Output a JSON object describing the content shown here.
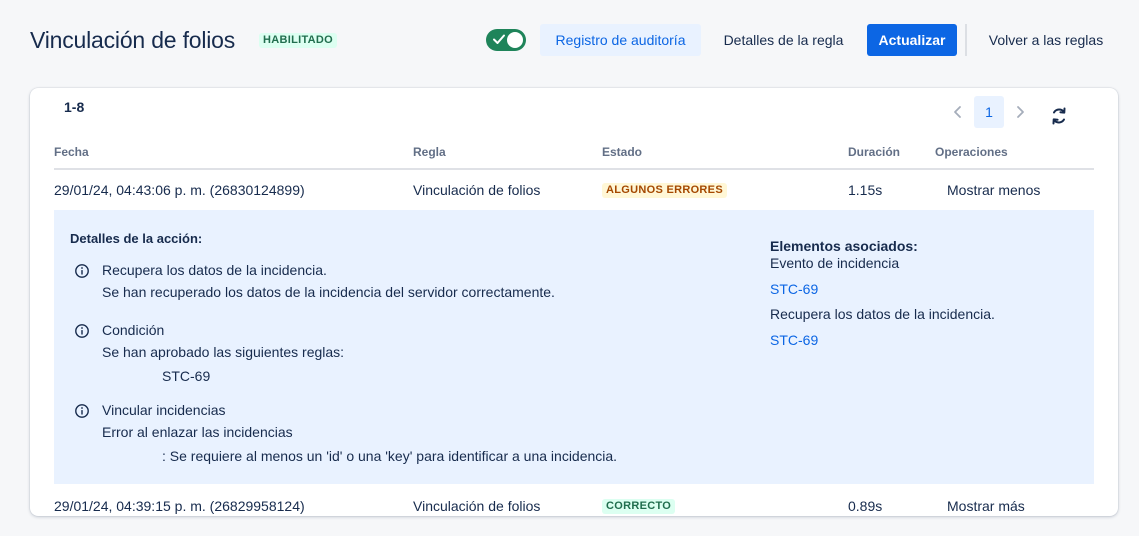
{
  "header": {
    "title": "Vinculación de folios",
    "status_badge": "HABILITADO",
    "toggle_on": true,
    "audit_button": "Registro de auditoría",
    "details_button": "Detalles de la regla",
    "update_button": "Actualizar",
    "back_button": "Volver a las reglas"
  },
  "table": {
    "range": "1-8",
    "pagination": {
      "current_page": "1"
    },
    "columns": [
      "Fecha",
      "Regla",
      "Estado",
      "Duración",
      "Operaciones"
    ],
    "rows": [
      {
        "date": "29/01/24, 04:43:06 p. m. (26830124899)",
        "rule": "Vinculación de folios",
        "status": "ALGUNOS ERRORES",
        "duration": "1.15s",
        "operation": "Mostrar menos"
      },
      {
        "date": "29/01/24, 04:39:15 p. m. (26829958124)",
        "rule": "Vinculación de folios",
        "status": "CORRECTO",
        "duration": "0.89s",
        "operation": "Mostrar más"
      }
    ]
  },
  "detail": {
    "title": "Detalles de la acción:",
    "actions": [
      {
        "title": "Recupera los datos de la incidencia.",
        "lines": [
          "Se han recuperado los datos de la incidencia del servidor correctamente."
        ]
      },
      {
        "title": "Condición",
        "lines": [
          "Se han aprobado las siguientes reglas:",
          "STC-69"
        ]
      },
      {
        "title": "Vincular incidencias",
        "lines": [
          "Error al enlazar las incidencias",
          ": Se requiere al menos un 'id' o una 'key' para identificar a una incidencia."
        ]
      }
    ],
    "associated": {
      "title": "Elementos asociados:",
      "items": [
        "Evento de incidencia",
        "STC-69",
        "Recupera los datos de la incidencia.",
        "STC-69"
      ]
    }
  },
  "colors": {
    "primary": "#0c66e4",
    "success": "#1f845a",
    "warning_bg": "#fff7d6",
    "warning_text": "#a54800",
    "detail_bg": "#e9f2ff"
  }
}
